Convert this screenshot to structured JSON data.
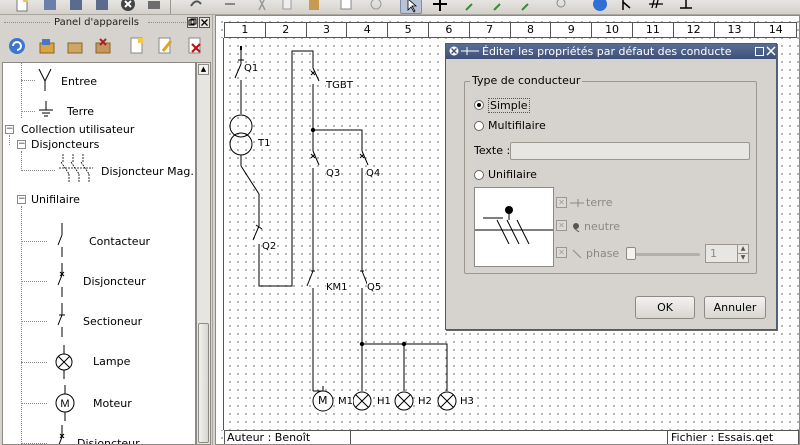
{
  "panel": {
    "title": "Panel d'appareils",
    "tree": {
      "entree": "Entree",
      "terre": "Terre",
      "collection": "Collection utilisateur",
      "disjoncteurs": "Disjoncteurs",
      "disjoncteur_mag": "Disjoncteur Mag...",
      "unifilaire": "Unifilaire",
      "contacteur": "Contacteur",
      "disjoncteur": "Disjoncteur",
      "sectioneur": "Sectioneur",
      "lampe": "Lampe",
      "moteur": "Moteur",
      "disjoncteur2": "Disjoncteur"
    }
  },
  "canvas": {
    "columns": [
      "1",
      "2",
      "3",
      "4",
      "5",
      "6",
      "7",
      "8",
      "9",
      "10",
      "11",
      "12",
      "13",
      "14"
    ],
    "labels": {
      "q1": "Q1",
      "tgbt": "TGBT",
      "t1": "T1",
      "q3": "Q3",
      "q4": "Q4",
      "q2": "Q2",
      "km1": "KM1",
      "q5": "Q5",
      "m1": "M1",
      "h1": "H1",
      "h2": "H2",
      "h3": "H3",
      "motor_symbol": "M"
    },
    "cartouche": {
      "author": "Auteur : Benoît Ansieau",
      "file": "Fichier : Essais.qet"
    }
  },
  "dialog": {
    "title": "Éditer les propriétés par défaut des conducte",
    "group_title": "Type de conducteur",
    "simple": "Simple",
    "multifilaire": "Multifilaire",
    "texte_label": "Texte :",
    "texte_value": "",
    "unifilaire": "Unifilaire",
    "terre": "terre",
    "neutre": "neutre",
    "phase": "phase",
    "phase_count": "1",
    "ok": "OK",
    "cancel": "Annuler",
    "selected_type": "Simple"
  }
}
